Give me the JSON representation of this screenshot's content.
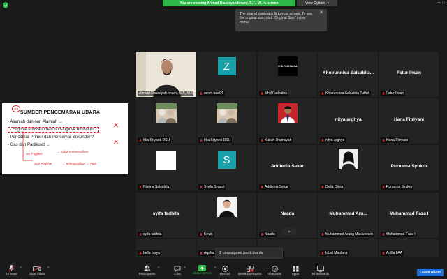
{
  "topbar": {
    "viewing_banner": "You are viewing Ahmad Daudsyah Imami, S.T., M...'s screen",
    "view_options": "View Options"
  },
  "tooltip": {
    "text": "The shared content is fit to your screen. To see the original size, click \"Original Size\" in the menu."
  },
  "shared_screen": {
    "badge": "TAH",
    "title": "SUMBER PENCEMARAN UDARA",
    "bullets": [
      "- Alamiah dan non Alamiah →",
      "- Fugitive emission dan non-fugitive emission ?",
      "- Pencemar Primer dan Pencemar Sekunder ?",
      "- Gas dan Partikulat →"
    ],
    "handwriting": [
      "Fugitive",
      "→ Tidak terkontrol/kan",
      "Non Fugitive",
      "→ terkontrol/kan → Pipa"
    ]
  },
  "gallery": {
    "tiles": [
      {
        "label": "Ahmad Daudsyah Imami, S.T., M.T.",
        "big": "",
        "kind": "video-main",
        "active": true,
        "muted": false
      },
      {
        "label": "zoom baa04",
        "big": "",
        "kind": "letter",
        "letter": "Z",
        "muted": true
      },
      {
        "label": "Mhd Fadhalna",
        "big": "",
        "kind": "logo",
        "logo_text": "MHD FADHALNA",
        "muted": true
      },
      {
        "label": "Khoirunnisa Salsabila Tuffah",
        "big": "Khoirunnisa  Salsabila...",
        "kind": "name",
        "muted": true
      },
      {
        "label": "Fatur Ihsan",
        "big": "Fatur Ihsan",
        "kind": "name",
        "muted": true
      },
      {
        "label": "Itka Sriyanti DSU",
        "big": "",
        "kind": "photo-group",
        "muted": true
      },
      {
        "label": "Itka Sriyanti DSU",
        "big": "",
        "kind": "photo-group",
        "muted": true
      },
      {
        "label": "Kukuh Ilhamsyah",
        "big": "",
        "kind": "photo-red",
        "muted": true
      },
      {
        "label": "nitya arghya",
        "big": "nitya arghya",
        "kind": "name",
        "muted": true
      },
      {
        "label": "Hana Fitriyani",
        "big": "Hana Fitriyani",
        "kind": "name",
        "muted": true
      },
      {
        "label": "Nisrina Salsabila",
        "big": "",
        "kind": "white",
        "muted": true
      },
      {
        "label": "Syafa Syauqi",
        "big": "",
        "kind": "letter",
        "letter": "S",
        "muted": true
      },
      {
        "label": "Addienia Sekar",
        "big": "Addienia Sekar",
        "kind": "name",
        "muted": true
      },
      {
        "label": "Della Olivia",
        "big": "",
        "kind": "photo-bw",
        "muted": true
      },
      {
        "label": "Purnama Syukro",
        "big": "Purnama Syukro",
        "kind": "name",
        "muted": true
      },
      {
        "label": "syifa fadhila",
        "big": "syifa fadhila",
        "kind": "name",
        "muted": true
      },
      {
        "label": "Kevin",
        "big": "",
        "kind": "photo-white",
        "muted": true
      },
      {
        "label": "Naada",
        "big": "Naada",
        "kind": "name",
        "muted": true
      },
      {
        "label": "Muhammad Arung Makkawaru",
        "big": "Muhammad  Aru...",
        "kind": "name",
        "muted": true
      },
      {
        "label": "Muhammad Faza I",
        "big": "Muhammad Faza I",
        "kind": "name",
        "muted": true
      },
      {
        "label": "bella fasya",
        "big": "bella fasya",
        "kind": "name",
        "muted": true
      },
      {
        "label": "Aqshal IF",
        "big": "Aqshal IF",
        "kind": "name",
        "muted": true
      },
      {
        "label": "Fatur Ihsan",
        "big": "Fatur Ihsan",
        "kind": "name",
        "muted": true
      },
      {
        "label": "Iqbal Maulana",
        "big": "Iqbal Maulana",
        "kind": "name",
        "muted": true
      },
      {
        "label": "Aqilla FAA",
        "big": "Aqilla FAA",
        "kind": "name",
        "muted": true
      }
    ]
  },
  "breakout": {
    "unassigned": "2 unassigned participants"
  },
  "toolbar": {
    "unmute": "Unmute",
    "start_video": "Start Video",
    "participants": "Participants",
    "participants_count": "44",
    "chat": "Chat",
    "share_screen": "Share Screen",
    "record": "Record",
    "breakout_rooms": "Breakout Rooms",
    "reactions": "Reactions",
    "apps": "Apps",
    "whiteboards": "Whiteboards",
    "leave": "Leave Room"
  },
  "colors": {
    "banner_green": "#2fb84a",
    "active_yellow": "#ded13f",
    "leave_blue": "#1f6fd6",
    "muted_red": "#e02f2f"
  }
}
